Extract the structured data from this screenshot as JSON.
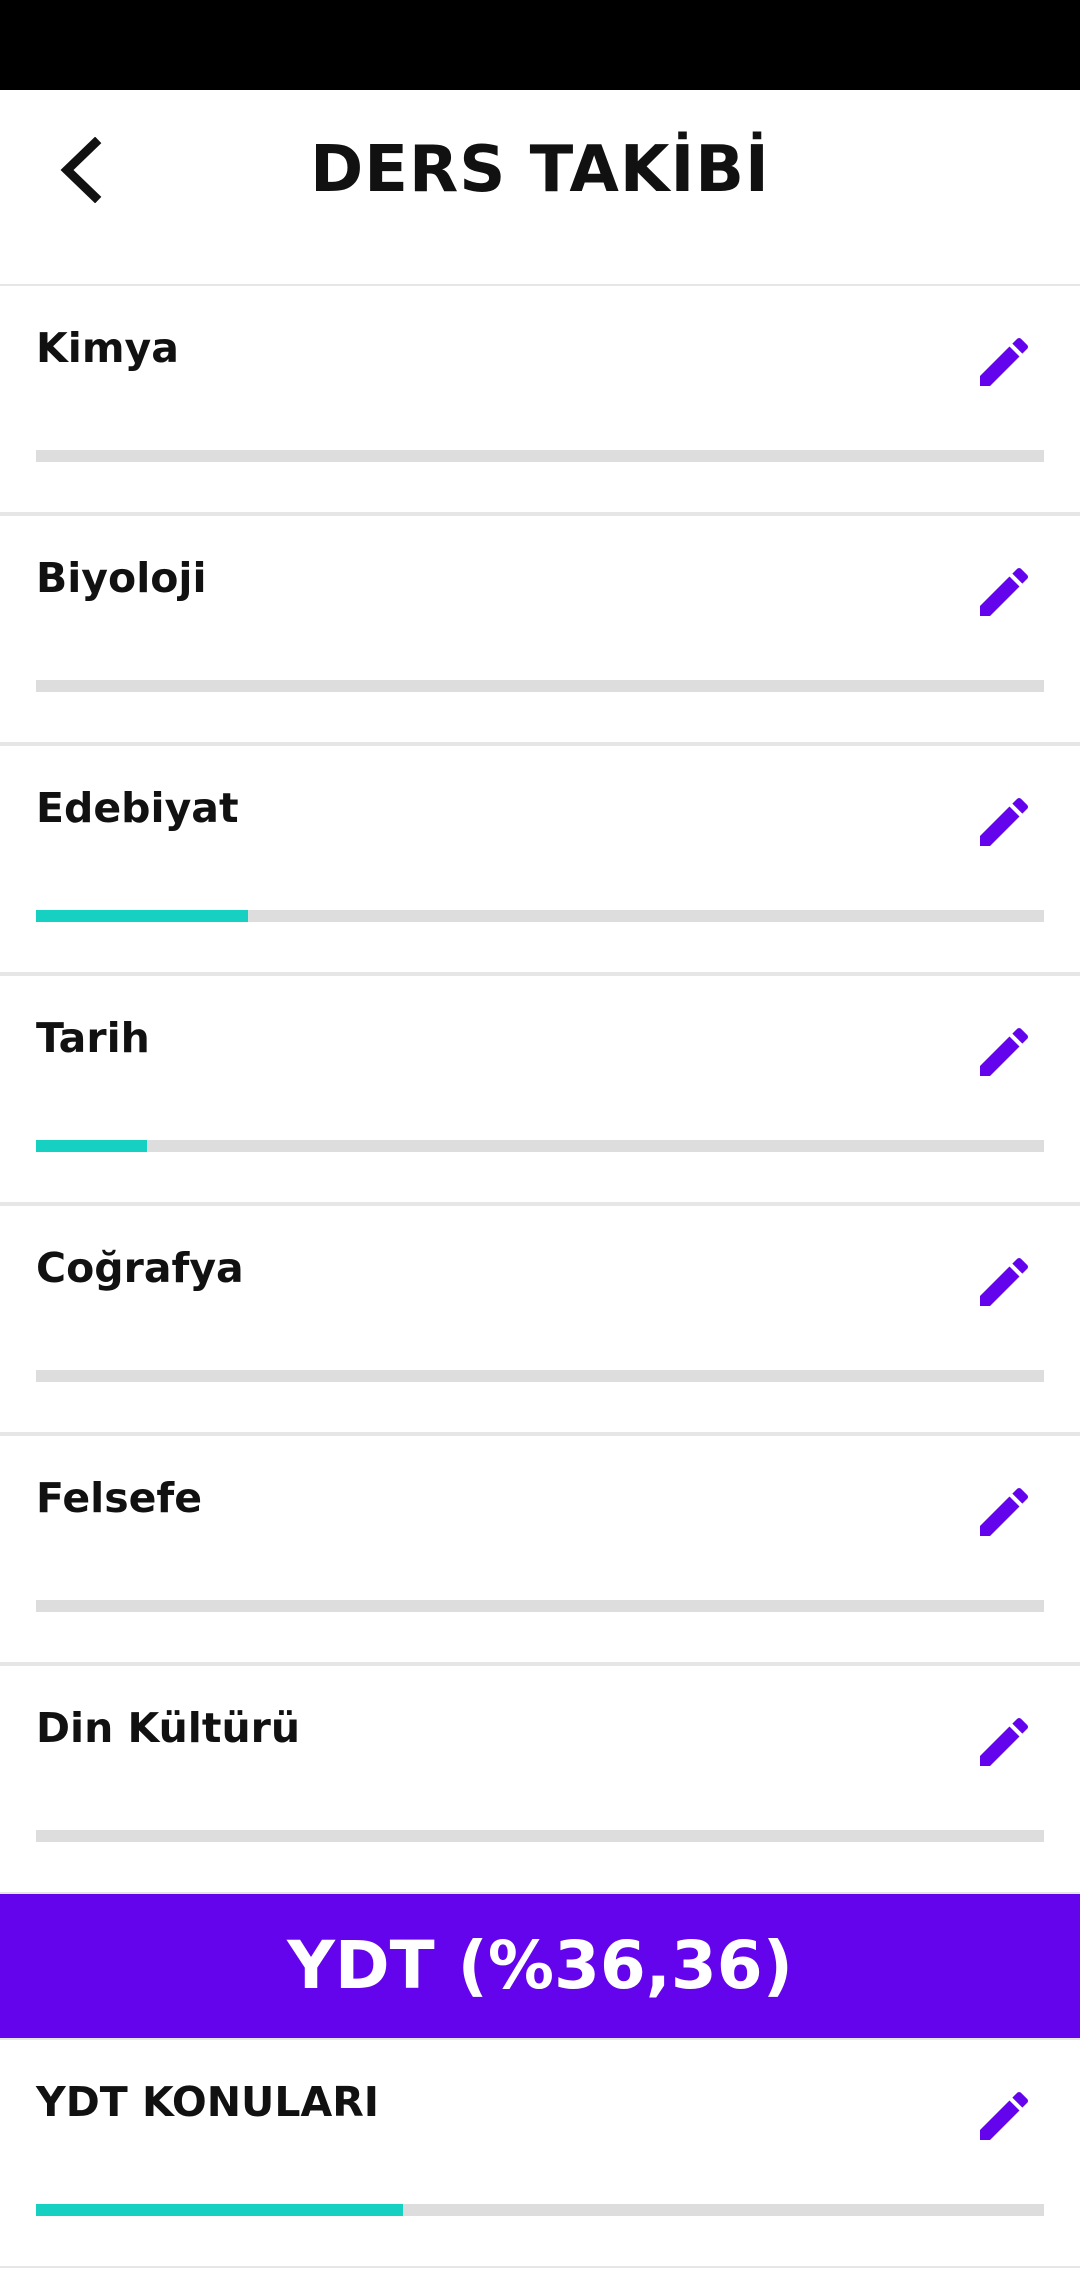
{
  "header": {
    "title": "DERS TAKİBİ",
    "back_icon": "chevron-left-icon"
  },
  "colors": {
    "accent": "#6304ec",
    "progress": "#16d0c2",
    "track": "#dddddd",
    "status_bar": "#000000"
  },
  "subjects": [
    {
      "label": "Kimya",
      "progress": 0,
      "icon": "pencil-icon"
    },
    {
      "label": "Biyoloji",
      "progress": 0,
      "icon": "pencil-icon"
    },
    {
      "label": "Edebiyat",
      "progress": 0.21,
      "icon": "pencil-icon"
    },
    {
      "label": "Tarih",
      "progress": 0.11,
      "icon": "pencil-icon"
    },
    {
      "label": "Coğrafya",
      "progress": 0,
      "icon": "pencil-icon"
    },
    {
      "label": "Felsefe",
      "progress": 0,
      "icon": "pencil-icon"
    },
    {
      "label": "Din Kültürü",
      "progress": 0,
      "icon": "pencil-icon"
    }
  ],
  "ydt": {
    "banner": "YDT (%36,36)",
    "items": [
      {
        "label": "YDT KONULARI",
        "progress": 0.3636,
        "icon": "pencil-icon"
      }
    ]
  }
}
